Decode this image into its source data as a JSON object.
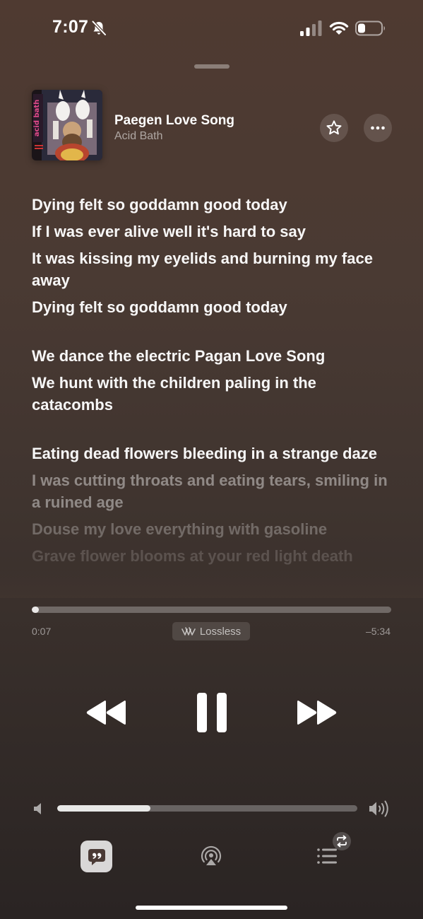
{
  "status_bar": {
    "time": "7:07"
  },
  "now_playing": {
    "title": "Paegen Love Song",
    "artist": "Acid Bath",
    "album_art_text": "acid bath"
  },
  "lyrics": [
    {
      "text": "Dying felt so goddamn good today",
      "state": "past",
      "gap_before": false
    },
    {
      "text": "If I was ever alive well it's hard to say",
      "state": "past",
      "gap_before": false
    },
    {
      "text": "It was kissing my eyelids and burning my face away",
      "state": "past",
      "gap_before": false
    },
    {
      "text": "Dying felt so goddamn good today",
      "state": "past",
      "gap_before": false
    },
    {
      "text": "We dance the electric Pagan Love Song",
      "state": "past",
      "gap_before": true
    },
    {
      "text": "We hunt with the children paling in the catacombs",
      "state": "past",
      "gap_before": false
    },
    {
      "text": "Eating dead flowers bleeding in a strange daze",
      "state": "past",
      "gap_before": true
    },
    {
      "text": "I was cutting throats and eating tears, smiling in a ruined age",
      "state": "upcoming",
      "gap_before": false
    },
    {
      "text": "Douse my love everything with gasoline",
      "state": "upcoming-far",
      "gap_before": false
    },
    {
      "text": "Grave flower blooms at your red light death",
      "state": "upcoming-faint",
      "gap_before": false
    }
  ],
  "playback": {
    "elapsed": "0:07",
    "remaining": "–5:34",
    "progress_fraction": 0.02,
    "quality_badge": "Lossless"
  },
  "volume": {
    "level_fraction": 0.31
  },
  "icons": {
    "status": [
      "mute-bell-icon",
      "cellular-signal-icon",
      "wifi-icon",
      "battery-icon"
    ],
    "header": [
      "star-icon",
      "ellipsis-icon"
    ],
    "transport": [
      "rewind-icon",
      "pause-icon",
      "fast-forward-icon"
    ],
    "volume": [
      "speaker-low-icon",
      "speaker-high-icon"
    ],
    "bottom": [
      "lyrics-quote-icon",
      "airplay-icon",
      "queue-list-icon",
      "repeat-icon"
    ]
  }
}
